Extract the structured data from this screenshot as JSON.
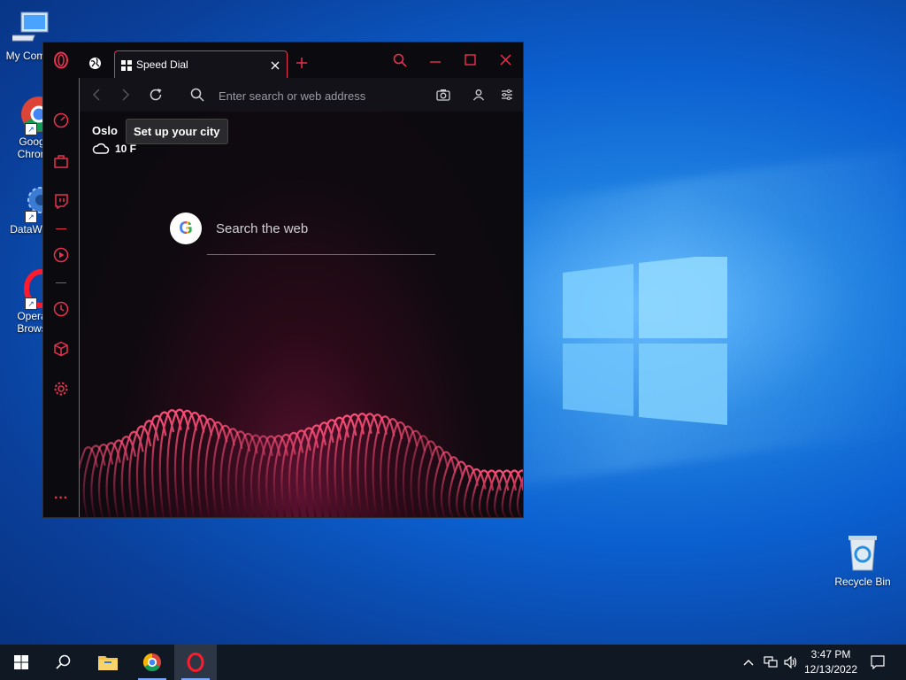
{
  "desktop": {
    "icons": [
      {
        "label": "My Com"
      },
      {
        "label": "Goog\nChron"
      },
      {
        "label": "DataWag"
      },
      {
        "label": "Opera\nBrows"
      }
    ],
    "recycle_bin": {
      "label": "Recycle Bin"
    }
  },
  "browser": {
    "tab": {
      "title": "Speed Dial"
    },
    "address_bar": {
      "placeholder": "Enter search or web address"
    },
    "weather": {
      "city": "Oslo",
      "tooltip": "Set up your city",
      "temperature": "10 F"
    },
    "search": {
      "label": "Search the web",
      "engine_letter": "G"
    },
    "sidebar_more": "···"
  },
  "taskbar": {
    "time": "3:47 PM",
    "date": "12/13/2022"
  },
  "colors": {
    "accent": "#e8324f",
    "desktop_blue": "#0b5fcf"
  }
}
